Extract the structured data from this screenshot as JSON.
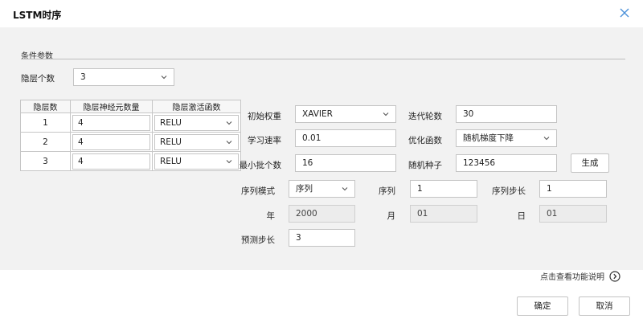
{
  "dialog": {
    "title": "LSTM时序"
  },
  "section": {
    "title": "条件参数"
  },
  "hidden_layers": {
    "label": "隐层个数",
    "value": "3"
  },
  "layer_table": {
    "headers": [
      "隐层数",
      "隐层神经元数量",
      "隐层激活函数"
    ],
    "rows": [
      {
        "index": "1",
        "neurons": "4",
        "activation": "RELU"
      },
      {
        "index": "2",
        "neurons": "4",
        "activation": "RELU"
      },
      {
        "index": "3",
        "neurons": "4",
        "activation": "RELU"
      }
    ]
  },
  "params": {
    "init_weight": {
      "label": "初始权重",
      "value": "XAVIER"
    },
    "iterations": {
      "label": "迭代轮数",
      "value": "30"
    },
    "learning_rate": {
      "label": "学习速率",
      "value": "0.01"
    },
    "optimizer": {
      "label": "优化函数",
      "value": "随机梯度下降"
    },
    "min_batch": {
      "label": "最小批个数",
      "value": "16"
    },
    "random_seed": {
      "label": "随机种子",
      "value": "123456"
    },
    "generate_button": "生成",
    "sequence_mode": {
      "label": "序列模式",
      "value": "序列"
    },
    "sequence": {
      "label": "序列",
      "value": "1"
    },
    "sequence_step": {
      "label": "序列步长",
      "value": "1"
    },
    "year": {
      "label": "年",
      "value": "2000"
    },
    "month": {
      "label": "月",
      "value": "01"
    },
    "day": {
      "label": "日",
      "value": "01"
    },
    "forecast_step": {
      "label": "预测步长",
      "value": "3"
    }
  },
  "help_link": "点击查看功能说明",
  "footer": {
    "ok_label": "确定",
    "cancel_label": "取消"
  },
  "colors": {
    "panel_bg": "#f2f2f2",
    "close_icon": "#4a90d9"
  },
  "icons": [
    "close-icon",
    "chevron-down-icon",
    "chevron-right-circle-icon"
  ]
}
